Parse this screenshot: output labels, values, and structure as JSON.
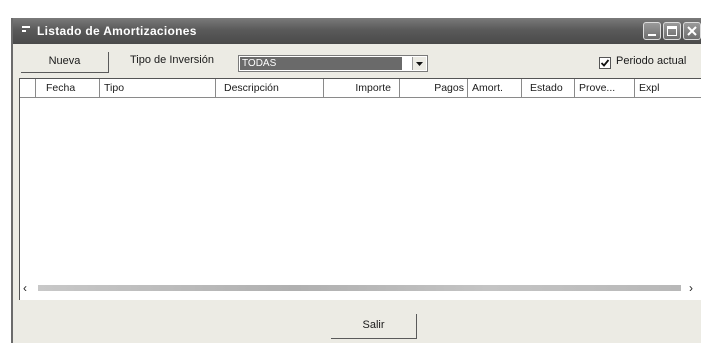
{
  "window": {
    "title": "Listado de Amortizaciones",
    "icon": "window-menu-icon",
    "controls": [
      "minimize-icon",
      "maximize-icon",
      "close-icon"
    ]
  },
  "toolbar": {
    "new_button": "Nueva",
    "investment_type_label": "Tipo de Inversión",
    "investment_type_value": "TODAS",
    "current_period_label": "Periodo actual",
    "current_period_checked": true
  },
  "table": {
    "columns": [
      "Fecha",
      "Tipo",
      "Descripción",
      "Importe",
      "Pagos",
      "Amort.",
      "Estado",
      "Prove...",
      "Expl"
    ],
    "rows": []
  },
  "scrollbar": {
    "left_arrow": "‹",
    "right_arrow": "›"
  },
  "footer": {
    "exit_button": "Salir"
  },
  "colors": {
    "titlebar": "#5a5a5a",
    "window_bg": "#ecebe4",
    "selection": "#6a6a6a"
  }
}
